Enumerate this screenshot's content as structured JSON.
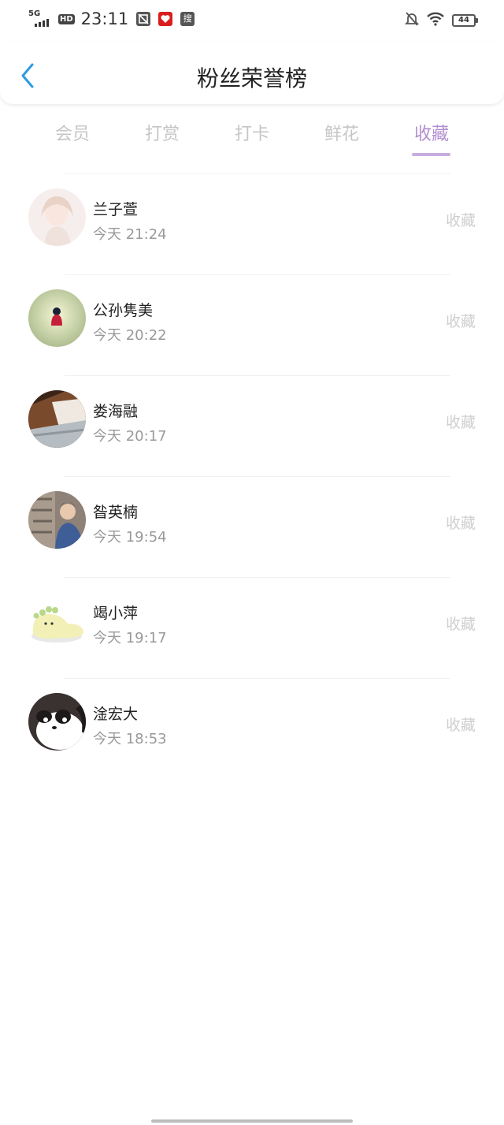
{
  "status_bar": {
    "network": "5G",
    "hd": "HD",
    "time": "23:11",
    "search_badge": "搜",
    "battery": "44"
  },
  "header": {
    "title": "粉丝荣誉榜"
  },
  "tabs": [
    {
      "label": "会员",
      "active": false
    },
    {
      "label": "打赏",
      "active": false
    },
    {
      "label": "打卡",
      "active": false
    },
    {
      "label": "鲜花",
      "active": false
    },
    {
      "label": "收藏",
      "active": true
    }
  ],
  "fans": [
    {
      "name": "兰子萱",
      "time": "今天 21:24",
      "action": "收藏"
    },
    {
      "name": "公孙隽美",
      "time": "今天 20:22",
      "action": "收藏"
    },
    {
      "name": "娄海融",
      "time": "今天 20:17",
      "action": "收藏"
    },
    {
      "name": "昝英楠",
      "time": "今天 19:54",
      "action": "收藏"
    },
    {
      "name": "竭小萍",
      "time": "今天 19:17",
      "action": "收藏"
    },
    {
      "name": "淦宏大",
      "time": "今天 18:53",
      "action": "收藏"
    }
  ],
  "colors": {
    "accent": "#b18ed0",
    "back_arrow": "#2b9be0",
    "inactive_tab": "#c6c6c6"
  }
}
